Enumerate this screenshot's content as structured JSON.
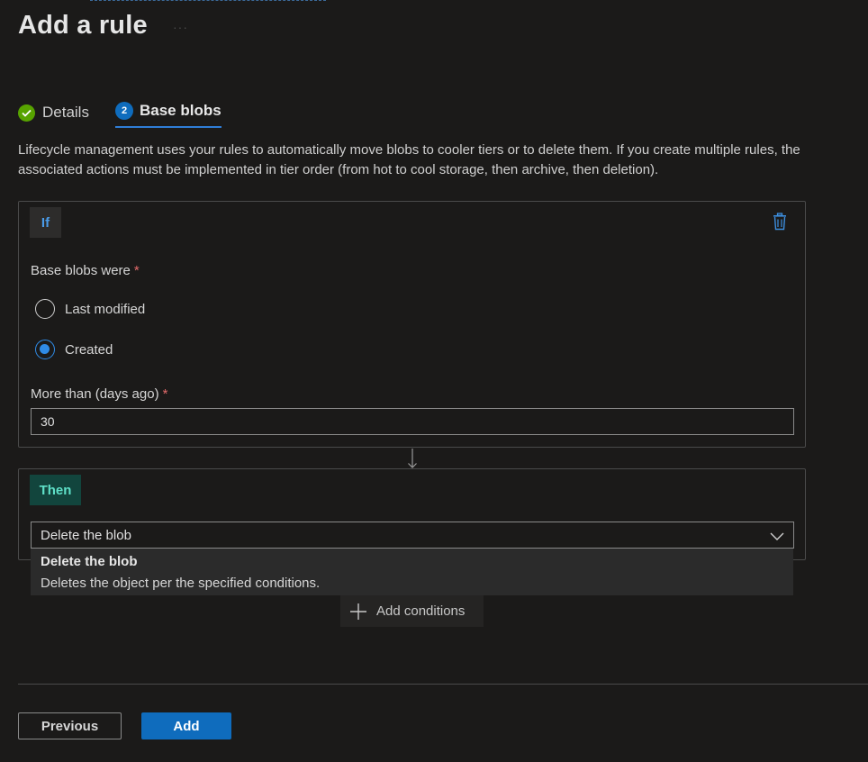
{
  "page": {
    "title": "Add a rule",
    "title_menu": "···"
  },
  "tabs": [
    {
      "label": "Details",
      "state": "completed",
      "icon": "check-icon"
    },
    {
      "label": "Base blobs",
      "state": "active",
      "step": "2"
    }
  ],
  "description": "Lifecycle management uses your rules to automatically move blobs to cooler tiers or to delete them. If you create multiple rules, the associated actions must be implemented in tier order (from hot to cool storage, then archive, then deletion).",
  "if_card": {
    "badge": "If",
    "base_blobs_label": "Base blobs were",
    "required_mark": "*",
    "options": [
      {
        "label": "Last modified",
        "selected": false
      },
      {
        "label": "Created",
        "selected": true
      }
    ],
    "days_label": "More than (days ago)",
    "days_value": "30"
  },
  "then_card": {
    "badge": "Then",
    "selected_action": "Delete the blob",
    "dropdown_option": {
      "title": "Delete the blob",
      "description": "Deletes the object per the specified conditions."
    }
  },
  "add_conditions_label": "Add conditions",
  "footer": {
    "previous_label": "Previous",
    "add_label": "Add"
  },
  "colors": {
    "accent": "#0f6cbd",
    "success": "#57a300",
    "then_badge_bg": "#12453d",
    "then_badge_text": "#5fe0c8",
    "required": "#e36b6b"
  }
}
